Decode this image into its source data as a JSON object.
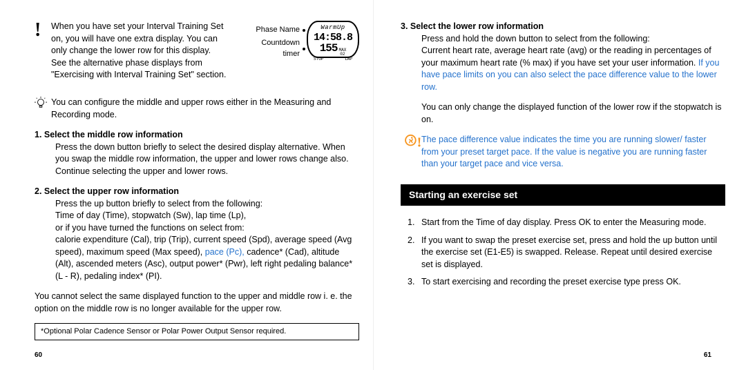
{
  "left": {
    "intro_note": "When you have set your Interval Training Set on, you will have one extra display. You can only change the lower row for this display. See the alternative phase displays from \"Exercising with Interval Training Set\" section.",
    "bulb_note": "You can configure the middle and upper rows either in the Measuring and Recording mode.",
    "step1_head": "1. Select the middle row information",
    "step1_body": "Press the down button briefly to select the desired display alternative. When you swap the middle row information, the upper and lower rows change also. Continue selecting the upper and lower rows.",
    "step2_head": "2. Select the upper row information",
    "step2_body1": "Press the up button briefly to select from the following:",
    "step2_body2": "Time of day (Time), stopwatch (Sw), lap time (Lp),",
    "step2_body3": "or if you have turned the functions on select from:",
    "step2_body4_a": "calorie expenditure (Cal), trip (Trip), current speed (Spd), average speed (Avg speed), maximum speed (Max speed), ",
    "step2_body4_b_blue": "pace (Pc),",
    "step2_body4_c": " cadence* (Cad), altitude (Alt), ascended meters (Asc), output power* (Pwr), left right pedaling balance* (L - R), pedaling index* (PI).",
    "cannot_sel": "You cannot select the same displayed function to the upper and middle row i. e. the option on the middle row is no longer available for the upper row.",
    "footnote": "*Optional Polar Cadence Sensor or Polar Power Output Sensor required.",
    "watch_label_phase": "Phase Name",
    "watch_label_timer": "Countdown timer",
    "watch_phase_text": "WarmUp",
    "watch_time_text": "14:58.8",
    "watch_hr_text": "155",
    "watch_small_l": "STOP",
    "watch_small_r": "LAP",
    "page_num": "60"
  },
  "right": {
    "step3_head": "3. Select the lower row information",
    "step3_a": "Press and hold the down button to select from the following:",
    "step3_b": "Current heart rate, average heart rate (avg) or the reading in percentages of your maximum heart rate (% max) if you have set your user information. ",
    "step3_c_blue": "If you have pace limits on you can also select the pace difference value to the lower row.",
    "step3_note": "You can only change the displayed function of the lower row if the stopwatch is on.",
    "pace_note_blue": "The pace difference value indicates the time you are running slower/ faster from your preset target pace. If the value is negative you are running faster than your target pace and vice versa.",
    "section_head": "Starting an exercise set",
    "ol1": "Start from the Time of day display. Press OK to enter the Measuring mode.",
    "ol2": "If you want to swap the preset exercise set, press and hold the up button until the exercise set (E1-E5) is swapped. Release. Repeat until desired exercise set is displayed.",
    "ol3": "To start exercising and recording the preset exercise type press OK.",
    "page_num": "61"
  }
}
